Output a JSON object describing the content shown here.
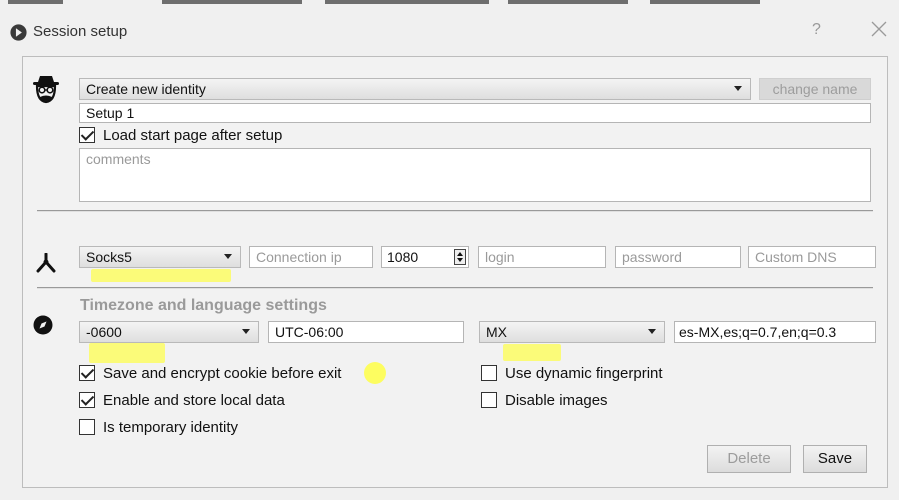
{
  "window": {
    "title": "Session setup",
    "help_label": "?"
  },
  "identity": {
    "select_value": "Create new identity",
    "change_name_label": "change name",
    "name_value": "Setup 1",
    "load_start_page": {
      "label": "Load start page after setup",
      "checked": true
    },
    "comments_placeholder": "comments"
  },
  "proxy": {
    "type_value": "Socks5",
    "ip_placeholder": "Connection ip",
    "port_value": "1080",
    "login_placeholder": "login",
    "password_placeholder": "password",
    "dns_placeholder": "Custom DNS"
  },
  "locale": {
    "section_title": "Timezone and language settings",
    "timezone_value": "-0600",
    "utc_value": "UTC-06:00",
    "country_value": "MX",
    "accept_language_value": "es-MX,es;q=0.7,en;q=0.3"
  },
  "options": {
    "save_cookie": {
      "label": "Save and encrypt cookie before exit",
      "checked": true
    },
    "local_data": {
      "label": "Enable and store local data",
      "checked": true
    },
    "temporary": {
      "label": "Is temporary identity",
      "checked": false
    },
    "dynamic_fp": {
      "label": "Use dynamic fingerprint",
      "checked": false
    },
    "disable_images": {
      "label": "Disable images",
      "checked": false
    }
  },
  "actions": {
    "delete_label": "Delete",
    "save_label": "Save"
  },
  "icons": {
    "app": "tor-logo-icon",
    "identity": "disguise-face-icon",
    "proxy": "network-node-icon",
    "locale": "compass-icon",
    "close": "close-icon"
  },
  "colors": {
    "highlight": "#ffff46"
  }
}
